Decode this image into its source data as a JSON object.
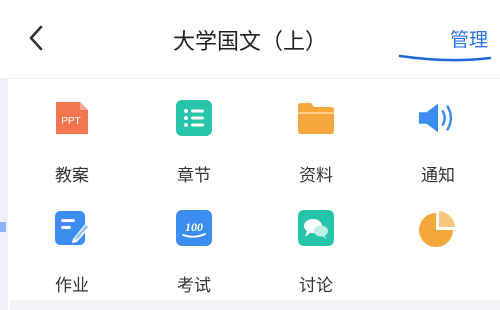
{
  "header": {
    "title": "大学国文（上）",
    "manage_label": "管理"
  },
  "tiles": [
    {
      "label": "教案",
      "icon": "ppt-icon",
      "icon_text": "PPT",
      "color": "#f2774f"
    },
    {
      "label": "章节",
      "icon": "list-icon",
      "color": "#26c4a8"
    },
    {
      "label": "资料",
      "icon": "folder-icon",
      "color": "#f4a73a"
    },
    {
      "label": "通知",
      "icon": "speaker-icon",
      "color": "#3b8df0"
    },
    {
      "label": "作业",
      "icon": "pencil-icon",
      "color": "#3b8df0"
    },
    {
      "label": "考试",
      "icon": "exam-100-icon",
      "icon_text": "100",
      "color": "#3b8df0"
    },
    {
      "label": "讨论",
      "icon": "chat-icon",
      "color": "#26c4a8"
    },
    {
      "label": "",
      "icon": "pie-chart-icon",
      "color": "#f4a73a"
    }
  ],
  "colors": {
    "accent": "#2a72e8",
    "annotation_underline": "#1f66d6"
  }
}
